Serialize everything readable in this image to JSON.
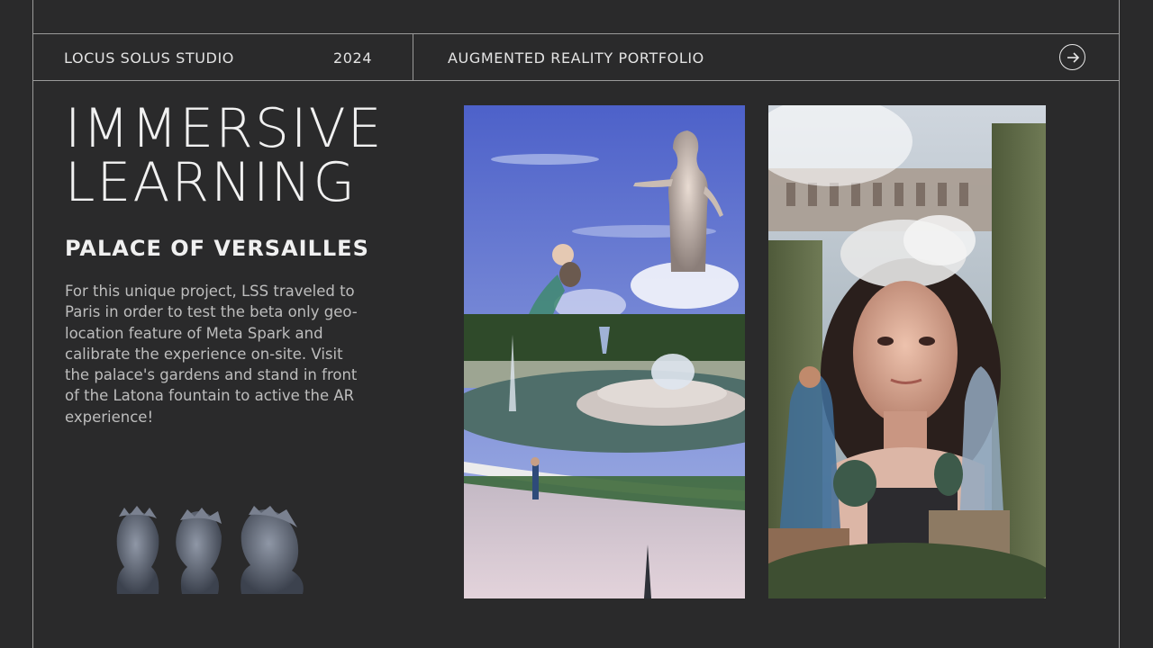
{
  "header": {
    "studio": "LOCUS SOLUS STUDIO",
    "year": "2024",
    "section": "AUGMENTED REALITY PORTFOLIO",
    "next_icon": "arrow-right-circle-icon"
  },
  "main": {
    "headline_line1": "IMMERSIVE",
    "headline_line2": "LEARNING",
    "subtitle": "PALACE OF VERSAILLES",
    "description": "For this unique project, LSS traveled to Paris in order to test the beta only geo-location feature of Meta Spark and calibrate the experience on-site. Visit the palace's gardens and stand in front of the Latona fountain to active the AR experience!"
  },
  "colors": {
    "background": "#2a2a2b",
    "rule": "#9a9a9a",
    "text": "#e9e9e9",
    "muted_text": "#bdbdbd"
  }
}
